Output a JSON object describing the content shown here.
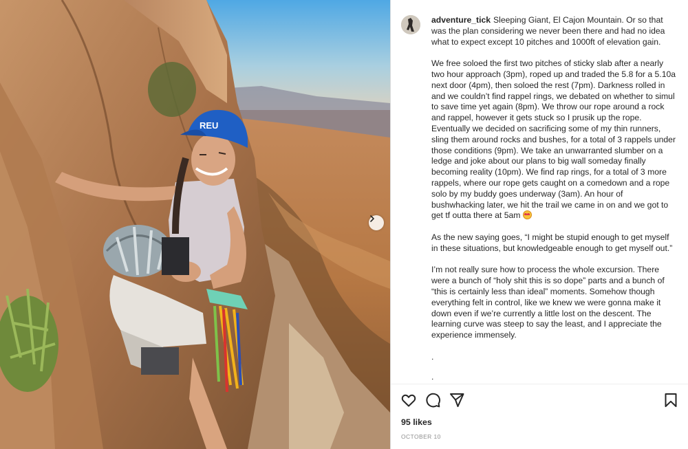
{
  "post": {
    "username": "adventure_tick",
    "caption_paragraphs": [
      "Sleeping Giant, El Cajon Mountain. Or so that was the plan considering we never been there and had no idea what to expect except 10 pitches and 1000ft of elevation gain.",
      "We free soloed the first two pitches of sticky slab after a nearly two hour approach (3pm), roped up and traded the 5.8 for a 5.10a next door (4pm), then soloed the rest (7pm). Darkness rolled in and we couldn’t find rappel rings, we debated on whether to simul to save time yet again (8pm). We throw our rope around a rock and rappel, however it gets stuck so I prusik up the rope. Eventually we decided on sacrificing some of my thin runners, sling them around rocks and bushes, for a total of 3 rappels under those conditions (9pm). We take an unwarranted slumber on a ledge and joke about our plans to big wall someday finally becoming reality (10pm). We find rap rings, for a total of 3 more rappels, where our rope gets caught on a comedown and a rope solo by my buddy goes underway (3am). An hour of bushwhacking later, we hit the trail we came in on and we got to get tf outta there at 5am",
      "As the new saying goes, “I might be stupid enough to get myself in these situations, but knowledgeable enough to get myself out.”",
      "I’m not really sure how to process the whole excursion. There were a bunch of “holy shit this is so dope” parts and a bunch of “this is certainly less than ideal” moments. Somehow though everything felt in control, like we knew we were gonna make it down even if we’re currently a little lost on the descent. The learning curve was steep to say the least, and I appreciate the experience immensely."
    ],
    "dots": [
      ".",
      "."
    ],
    "likes": "95 likes",
    "date": "October 10",
    "hat_text": "REU"
  },
  "icons": {
    "like": "heart-icon",
    "comment": "comment-icon",
    "share": "send-icon",
    "save": "bookmark-icon",
    "next": "chevron-right-icon"
  },
  "colors": {
    "text": "#262626",
    "muted": "#8e8e8e",
    "border": "#dbdbdb",
    "hat": "#1f5fc4"
  }
}
